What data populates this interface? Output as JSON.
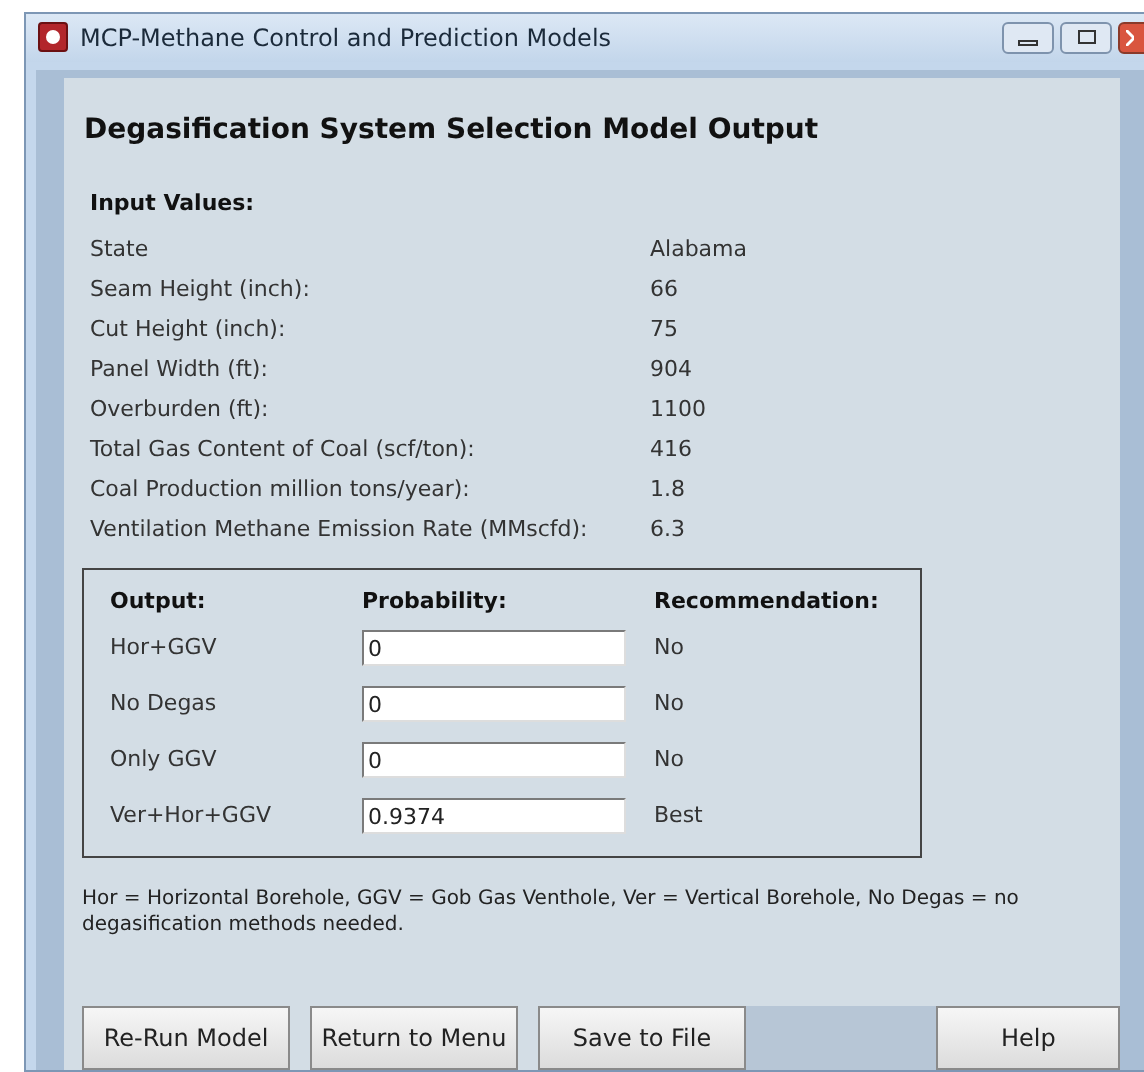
{
  "window": {
    "title": "MCP-Methane Control and Prediction Models"
  },
  "heading": "Degasification System Selection Model Output",
  "inputs": {
    "title": "Input Values:",
    "rows": [
      {
        "label": "State",
        "value": "Alabama"
      },
      {
        "label": "Seam Height (inch):",
        "value": "66"
      },
      {
        "label": "Cut Height (inch):",
        "value": "75"
      },
      {
        "label": "Panel Width (ft):",
        "value": "904"
      },
      {
        "label": "Overburden (ft):",
        "value": "1100"
      },
      {
        "label": "Total Gas Content of Coal (scf/ton):",
        "value": "416"
      },
      {
        "label": "Coal Production million tons/year):",
        "value": "1.8"
      },
      {
        "label": "Ventilation Methane Emission Rate (MMscfd):",
        "value": "6.3"
      }
    ]
  },
  "output": {
    "columns": [
      "Output:",
      "Probability:",
      "Recommendation:"
    ],
    "rows": [
      {
        "name": "Hor+GGV",
        "probability": "0",
        "recommendation": "No"
      },
      {
        "name": "No Degas",
        "probability": "0",
        "recommendation": "No"
      },
      {
        "name": "Only GGV",
        "probability": "0",
        "recommendation": "No"
      },
      {
        "name": "Ver+Hor+GGV",
        "probability": "0.9374",
        "recommendation": "Best"
      }
    ]
  },
  "note": "Hor = Horizontal Borehole, GGV = Gob Gas Venthole, Ver = Vertical  Borehole, No Degas = no degasification methods needed.",
  "buttons": [
    "Re-Run Model",
    "Return to Menu",
    "Save to File"
  ],
  "help_button": "Help"
}
